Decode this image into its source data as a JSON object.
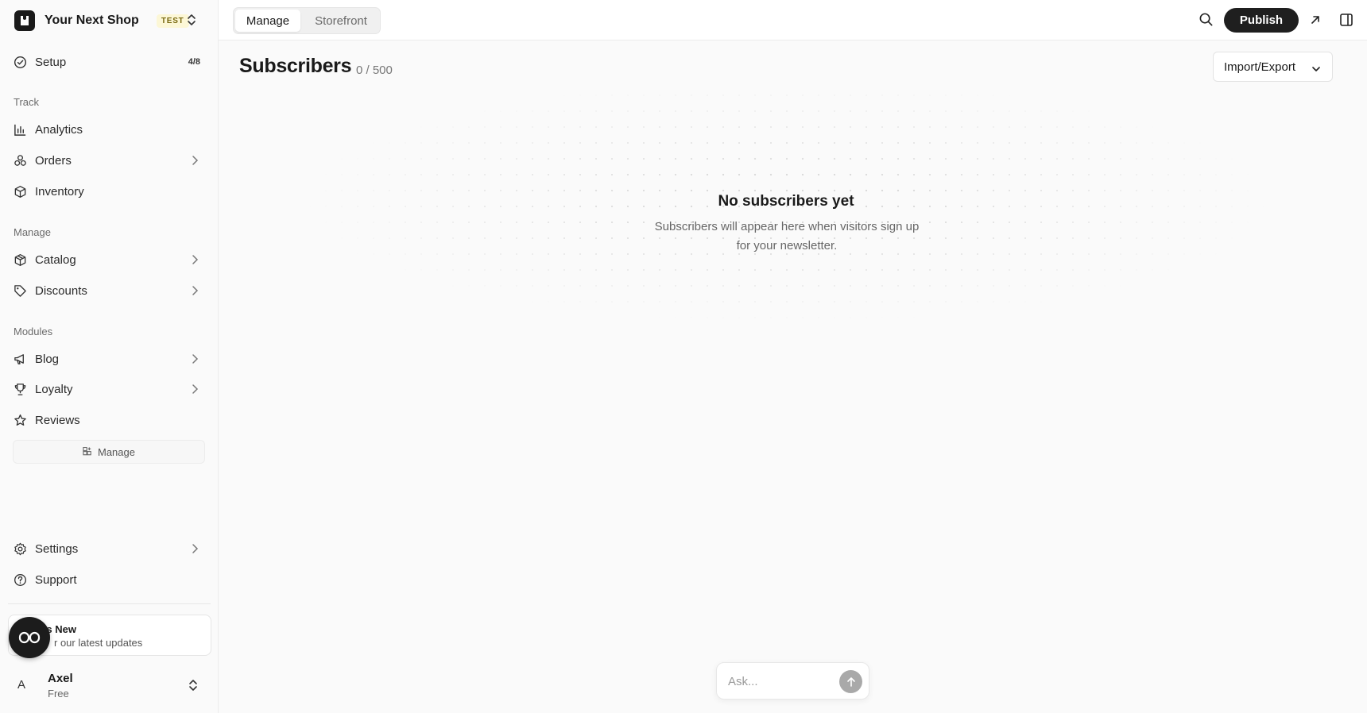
{
  "shop": {
    "name": "Your Next Shop",
    "badge": "TEST"
  },
  "sidebar": {
    "setup": {
      "label": "Setup",
      "progress": "4/8"
    },
    "sections": {
      "track": "Track",
      "manage": "Manage",
      "modules": "Modules"
    },
    "track_items": [
      {
        "label": "Analytics"
      },
      {
        "label": "Orders"
      },
      {
        "label": "Inventory"
      }
    ],
    "manage_items": [
      {
        "label": "Catalog"
      },
      {
        "label": "Discounts"
      }
    ],
    "module_items": [
      {
        "label": "Blog"
      },
      {
        "label": "Loyalty"
      },
      {
        "label": "Reviews"
      }
    ],
    "manage_modules_label": "Manage",
    "settings": "Settings",
    "support": "Support",
    "whats_new": {
      "title": "t's New",
      "subtitle": "r our latest updates"
    },
    "user": {
      "initial": "A",
      "name": "Axel",
      "plan": "Free"
    }
  },
  "topbar": {
    "tabs": [
      {
        "label": "Manage",
        "active": true
      },
      {
        "label": "Storefront",
        "active": false
      }
    ],
    "publish_label": "Publish"
  },
  "main": {
    "title": "Subscribers",
    "count": "0 / 500",
    "import_export_label": "Import/Export",
    "empty_title": "No subscribers yet",
    "empty_subtitle": "Subscribers will appear here when visitors sign up for your newsletter."
  },
  "ask": {
    "placeholder": "Ask..."
  },
  "colors": {
    "primary_button": "#1f1f1f",
    "test_badge_bg": "#fcf7d6",
    "background": "#fafafa"
  }
}
